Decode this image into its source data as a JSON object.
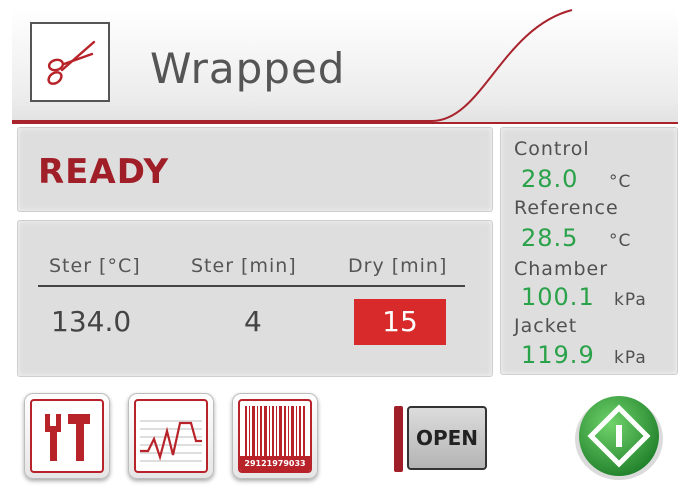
{
  "header": {
    "program_name": "Wrapped",
    "program_icon": "scissors-icon"
  },
  "status": {
    "text": "READY"
  },
  "cycle_parameters": {
    "columns": [
      {
        "header": "Ster [°C]",
        "value": "134.0"
      },
      {
        "header": "Ster [min]",
        "value": "4"
      },
      {
        "header": "Dry [min]",
        "value": "15",
        "highlighted": true
      }
    ]
  },
  "readings": [
    {
      "label": "Control",
      "value": "28.0",
      "unit": "°C"
    },
    {
      "label": "Reference",
      "value": "28.5",
      "unit": "°C"
    },
    {
      "label": "Chamber",
      "value": "100.1",
      "unit": "kPa"
    },
    {
      "label": "Jacket",
      "value": "119.9",
      "unit": "kPa"
    }
  ],
  "toolbar": {
    "settings_icon": "tools-icon",
    "graph_icon": "graph-icon",
    "barcode_icon": "barcode-icon",
    "barcode_number": "29121979033",
    "door_button_label": "OPEN",
    "start_icon": "start-icon"
  },
  "colors": {
    "accent_red": "#a01e28",
    "reading_green": "#2aa24a",
    "highlight_red": "#d82a2a",
    "start_green": "#2f9d3a"
  }
}
